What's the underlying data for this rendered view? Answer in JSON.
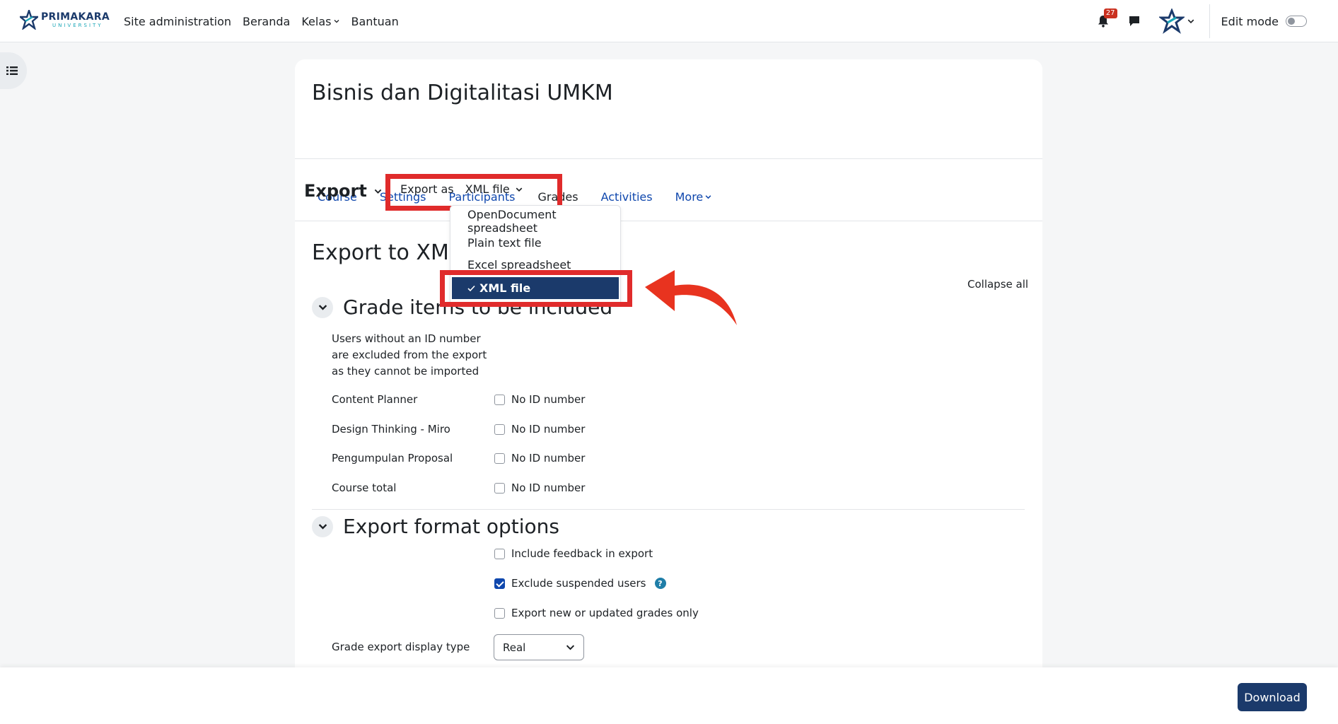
{
  "brand": {
    "name": "PRIMAKARA",
    "sub": "UNIVERSITY"
  },
  "nav": {
    "items": [
      {
        "label": "Site administration"
      },
      {
        "label": "Beranda"
      },
      {
        "label": "Kelas"
      },
      {
        "label": "Bantuan"
      }
    ],
    "notification_count": "27",
    "edit_mode_label": "Edit mode"
  },
  "course": {
    "title": "Bisnis dan Digitalitasi UMKM",
    "tabs": [
      {
        "label": "Course"
      },
      {
        "label": "Settings"
      },
      {
        "label": "Participants"
      },
      {
        "label": "Grades"
      },
      {
        "label": "Activities"
      },
      {
        "label": "More"
      }
    ],
    "active_tab": "Grades"
  },
  "action_bar": {
    "heading": "Export",
    "export_as_label": "Export as",
    "export_as_value": "XML file"
  },
  "dropdown": {
    "options": [
      {
        "label": "OpenDocument spreadsheet"
      },
      {
        "label": "Plain text file"
      },
      {
        "label": "Excel spreadsheet"
      },
      {
        "label": "XML file"
      }
    ],
    "selected": "XML file"
  },
  "page": {
    "title": "Export to XML",
    "collapse_all": "Collapse all"
  },
  "grade_items": {
    "heading": "Grade items to be included",
    "note": "Users without an ID number are excluded from the export as they cannot be imported",
    "rows": [
      {
        "label": "Content Planner",
        "value": "No ID number"
      },
      {
        "label": "Design Thinking - Miro",
        "value": "No ID number"
      },
      {
        "label": "Pengumpulan Proposal",
        "value": "No ID number"
      },
      {
        "label": "Course total",
        "value": "No ID number"
      }
    ]
  },
  "format_options": {
    "heading": "Export format options",
    "options": [
      {
        "label": "Include feedback in export",
        "checked": false
      },
      {
        "label": "Exclude suspended users",
        "checked": true
      },
      {
        "label": "Export new or updated grades only",
        "checked": false
      }
    ],
    "display_type_label": "Grade export display type",
    "display_type_value": "Real"
  },
  "footer": {
    "download_label": "Download"
  },
  "colors": {
    "accent": "#1b3a6b",
    "link": "#0f47ad",
    "highlight": "#e02b2b"
  }
}
